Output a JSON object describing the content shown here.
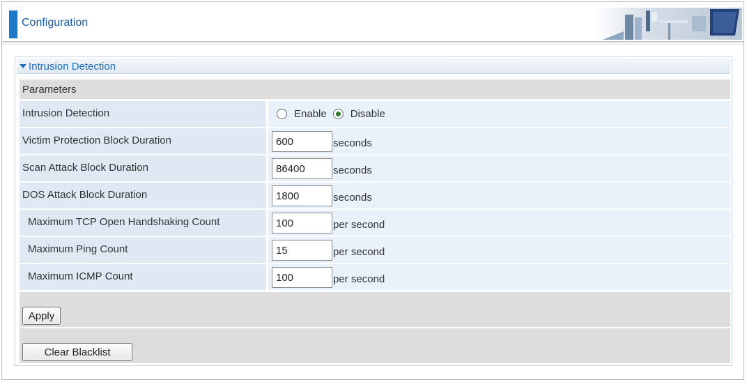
{
  "header": {
    "title": "Configuration"
  },
  "panel": {
    "title": "Intrusion Detection"
  },
  "parameters": {
    "heading": "Parameters",
    "intrusion_detection": {
      "label": "Intrusion Detection",
      "options": [
        {
          "label": "Enable",
          "checked": false
        },
        {
          "label": "Disable",
          "checked": true
        }
      ]
    },
    "rows": [
      {
        "label": "Victim Protection Block Duration",
        "value": "600",
        "unit": "seconds",
        "indent": false
      },
      {
        "label": "Scan Attack Block Duration",
        "value": "86400",
        "unit": "seconds",
        "indent": false
      },
      {
        "label": "DOS Attack Block Duration",
        "value": "1800",
        "unit": "seconds",
        "indent": false
      },
      {
        "label": "Maximum TCP Open Handshaking Count",
        "value": "100",
        "unit": "per second",
        "indent": true
      },
      {
        "label": "Maximum Ping Count",
        "value": "15",
        "unit": "per second",
        "indent": true
      },
      {
        "label": "Maximum ICMP Count",
        "value": "100",
        "unit": "per second",
        "indent": true
      }
    ]
  },
  "buttons": {
    "apply": "Apply",
    "clear_blacklist": "Clear Blacklist"
  },
  "colors": {
    "accent": "#1e78c8",
    "title_text": "#1a6fc0",
    "row_label_bg": "#dfe9f4",
    "row_value_bg": "#e9f2fb",
    "section_bg": "#dddddd"
  },
  "icons": {
    "collapse": "triangle-down-icon",
    "header_art": "office-illustration-icon"
  }
}
